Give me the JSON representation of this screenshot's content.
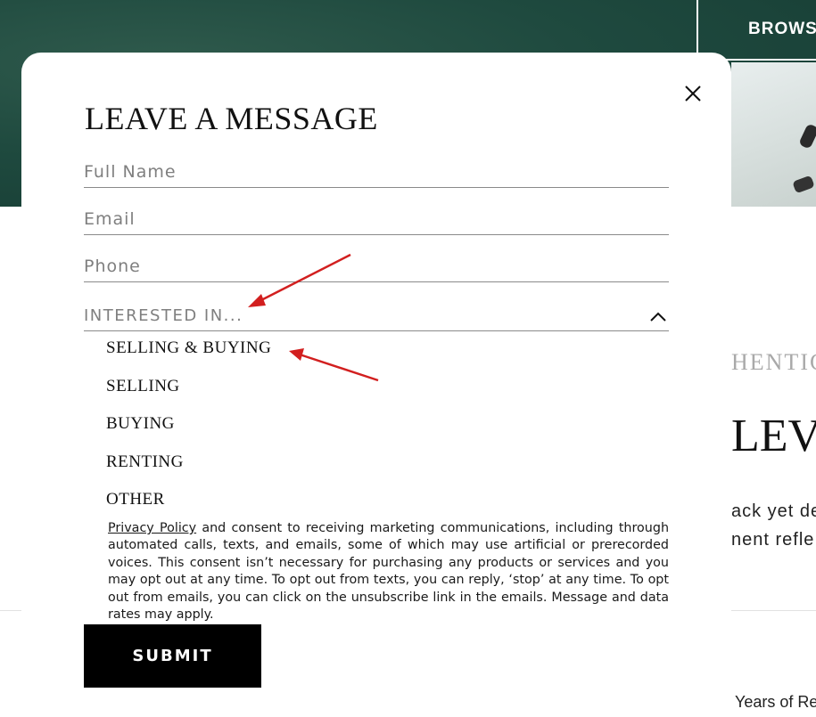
{
  "background": {
    "browse_label": "BROWSE",
    "subhead": "HENTIC",
    "heading": "LEV",
    "line1": "ack yet de",
    "line2": "nent refle",
    "years": "Years of Rea"
  },
  "modal": {
    "title": "LEAVE A MESSAGE",
    "close_icon": "close-icon",
    "fields": {
      "full_name_placeholder": "Full Name",
      "email_placeholder": "Email",
      "phone_placeholder": "Phone"
    },
    "interested": {
      "label": "INTERESTED IN...",
      "icon": "chevron-up-icon",
      "options": [
        "SELLING & BUYING",
        "SELLING",
        "BUYING",
        "RENTING",
        "OTHER"
      ]
    },
    "consent": {
      "link_text": "Privacy Policy",
      "body": " and consent to receiving marketing communications, including through automated calls, texts, and emails, some of which may use artificial or prerecorded voices. This consent isn’t necessary for purchasing any products or services and you may opt out at any time. To opt out from texts, you can reply, ‘stop’ at any time. To opt out from emails, you can click on the unsubscribe link in the emails. Message and data rates may apply."
    },
    "submit_label": "SUBMIT"
  },
  "colors": {
    "annotation_arrow": "#d21f1f",
    "hero_green": "#1f4a3f",
    "button_black": "#000000"
  }
}
